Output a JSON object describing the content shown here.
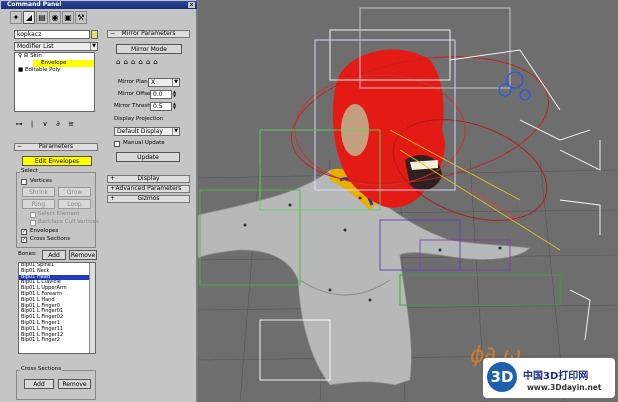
{
  "window": {
    "title": "Command Panel",
    "close": "x"
  },
  "tabs": [
    {
      "name": "create-tab",
      "glyph": "✦"
    },
    {
      "name": "modify-tab",
      "glyph": "◢"
    },
    {
      "name": "hierarchy-tab",
      "glyph": "▤"
    },
    {
      "name": "motion-tab",
      "glyph": "◉"
    },
    {
      "name": "display-tab",
      "glyph": "▣"
    },
    {
      "name": "utilities-tab",
      "glyph": "⚒"
    }
  ],
  "object_name": "kopkacz",
  "modifier_list": "Modifier List",
  "stack": {
    "items": [
      "Skin",
      "Envelope",
      "Editable Poly"
    ]
  },
  "stack_icons": [
    "⊶",
    "|",
    "∨",
    "∂",
    "≡"
  ],
  "parameters": {
    "header": "Parameters",
    "edit_envelopes": "Edit Envelopes",
    "select_label": "Select",
    "vertices": "Vertices",
    "shrink": "Shrink",
    "grow": "Grow",
    "ring": "Ring",
    "loop": "Loop",
    "select_element": "Select Element",
    "backface_cull": "Backface Cull Vertices",
    "envelopes": "Envelopes",
    "cross_sections": "Cross Sections",
    "bones_label": "Bones:",
    "add": "Add",
    "remove": "Remove"
  },
  "bones": [
    "Bip01 Spine1",
    "Bip01 Neck",
    "Bip01 Head",
    "Bip01 L Clavicle",
    "Bip01 L UpperArm",
    "Bip01 L Forearm",
    "Bip01 L Hand",
    "Bip01 L Finger0",
    "Bip01 L Finger01",
    "Bip01 L Finger02",
    "Bip01 L Finger1",
    "Bip01 L Finger11",
    "Bip01 L Finger12",
    "Bip01 L Finger2"
  ],
  "selected_bone": "Bip01 Head",
  "cross_sections_group": {
    "label": "Cross Sections",
    "add": "Add",
    "remove": "Remove"
  },
  "mirror": {
    "header": "Mirror Parameters",
    "mode": "Mirror Mode",
    "icons": [
      "⌂",
      "⌂",
      "⌂",
      "⌂",
      "⌂",
      "⌂"
    ],
    "plane_label": "Mirror Plane:",
    "plane_value": "X",
    "offset_label": "Mirror Offset:",
    "offset_value": "0.0",
    "thresh_label": "Mirror Thresh.:",
    "thresh_value": "0.5",
    "projection_label": "Display Projection",
    "projection_value": "Default Display",
    "manual_update": "Manual Update",
    "update": "Update"
  },
  "rollouts": {
    "display": "Display",
    "advanced": "Advanced Parameters",
    "gizmos": "Gizmos"
  },
  "logo": {
    "mark": "3D",
    "name": "中国3D打印网",
    "url": "www.3Ddayin.net"
  },
  "colors": {
    "highlight": "#ffff00",
    "selection": "#1f3bbf",
    "viewport_bg": "#6b6b6b",
    "head": "#e01010"
  }
}
